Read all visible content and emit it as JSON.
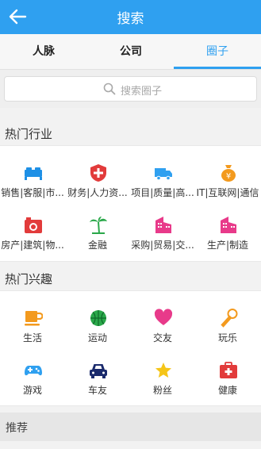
{
  "header": {
    "title": "搜索"
  },
  "tabs": [
    {
      "label": "人脉"
    },
    {
      "label": "公司"
    },
    {
      "label": "圈子"
    }
  ],
  "search": {
    "placeholder": "搜索圈子"
  },
  "hot_industry": {
    "title": "热门行业",
    "items": [
      {
        "label": "销售|客服|市...",
        "icon": "bed-icon",
        "color": "#1e90e6"
      },
      {
        "label": "财务|人力资...",
        "icon": "shield-cross-icon",
        "color": "#e23b3b"
      },
      {
        "label": "项目|质量|高...",
        "icon": "truck-icon",
        "color": "#2fa0f0"
      },
      {
        "label": "IT|互联网|通信",
        "icon": "money-bag-icon",
        "color": "#f39a1e"
      },
      {
        "label": "房产|建筑|物...",
        "icon": "camera-icon",
        "color": "#e23b3b"
      },
      {
        "label": "金融",
        "icon": "palm-tree-icon",
        "color": "#2aa84a"
      },
      {
        "label": "采购|贸易|交...",
        "icon": "buildings-icon",
        "color": "#e83a8a"
      },
      {
        "label": "生产|制造",
        "icon": "factory-icon",
        "color": "#e83a8a"
      }
    ]
  },
  "hot_interest": {
    "title": "热门兴趣",
    "items": [
      {
        "label": "生活",
        "icon": "cup-icon",
        "color": "#f39a1e"
      },
      {
        "label": "运动",
        "icon": "basketball-icon",
        "color": "#2aa84a"
      },
      {
        "label": "交友",
        "icon": "heart-icon",
        "color": "#e83a8a"
      },
      {
        "label": "玩乐",
        "icon": "microphone-icon",
        "color": "#f39a1e"
      },
      {
        "label": "游戏",
        "icon": "gamepad-icon",
        "color": "#2fa0f0"
      },
      {
        "label": "车友",
        "icon": "car-icon",
        "color": "#1a2a6c"
      },
      {
        "label": "粉丝",
        "icon": "star-icon",
        "color": "#f5c518"
      },
      {
        "label": "健康",
        "icon": "first-aid-icon",
        "color": "#e23b3b"
      }
    ]
  },
  "recommend": {
    "title": "推荐"
  }
}
